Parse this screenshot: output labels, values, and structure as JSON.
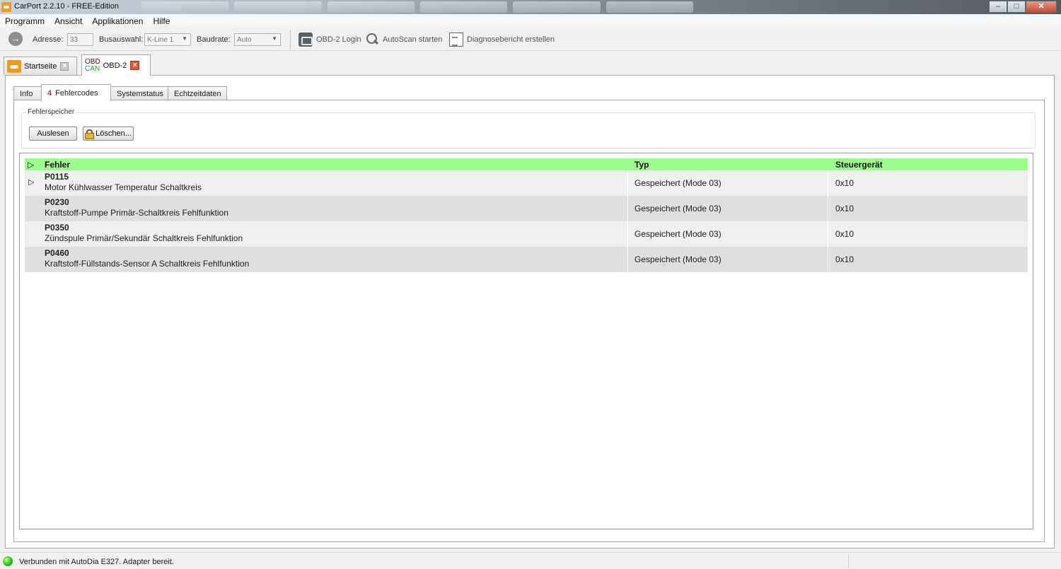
{
  "window": {
    "title": "CarPort 2.2.10  - FREE-Edition",
    "close_glyph": "✕",
    "maximize_glyph": "□",
    "minimize_glyph": "–"
  },
  "menu": [
    "Programm",
    "Ansicht",
    "Applikationen",
    "Hilfe"
  ],
  "toolbar": {
    "address_label": "Adresse:",
    "address_value": "33",
    "bus_label": "Busauswahl:",
    "bus_value": "K-Line 1",
    "baud_label": "Baudrate:",
    "baud_value": "Auto",
    "obd_login": "OBD-2 Login",
    "autoscan": "AutoScan starten",
    "report": "Diagnosebericht erstellen"
  },
  "doc_tabs": {
    "start": "Startseite",
    "obd_top": "OBD",
    "obd_bottom": "CAN",
    "obd_label": "OBD-2"
  },
  "inner_tabs": {
    "info": "Info",
    "error_count": "4",
    "errors": "Fehlercodes",
    "system": "Systemstatus",
    "live": "Echtzeitdaten"
  },
  "memory": {
    "legend": "Fehlerspeicher",
    "read_button": "Auslesen",
    "clear_button": "Löschen..."
  },
  "table": {
    "headers": [
      "Fehler",
      "Typ",
      "Steuergerät"
    ],
    "rows": [
      {
        "code": "P0115",
        "desc": "Motor Kühlwasser Temperatur Schaltkreis",
        "type": "Gespeichert (Mode 03)",
        "ecu": "0x10"
      },
      {
        "code": "P0230",
        "desc": "Kraftstoff-Pumpe Primär-Schaltkreis Fehlfunktion",
        "type": "Gespeichert (Mode 03)",
        "ecu": "0x10"
      },
      {
        "code": "P0350",
        "desc": "Zündspule Primär/Sekundär Schaltkreis Fehlfunktion",
        "type": "Gespeichert (Mode 03)",
        "ecu": "0x10"
      },
      {
        "code": "P0460",
        "desc": "Kraftstoff-Füllstands-Sensor A Schaltkreis Fehlfunktion",
        "type": "Gespeichert (Mode 03)",
        "ecu": "0x10"
      }
    ]
  },
  "status": {
    "text": "Verbunden mit AutoDia E327. Adapter bereit.",
    "led_color": "#24b81a"
  },
  "colors": {
    "header_green": "#9dfd8f",
    "accent_orange": "#f39a1e",
    "error_count_red": "#c0392b"
  }
}
